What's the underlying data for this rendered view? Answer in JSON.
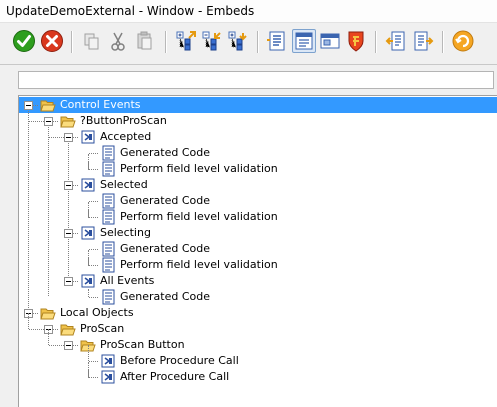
{
  "window": {
    "title": "UpdateDemoExternal - Window - Embeds"
  },
  "toolbar": {
    "buttons": [
      {
        "name": "ok-icon",
        "color": "#2e9e1e"
      },
      {
        "name": "cancel-icon",
        "color": "#d9381e"
      },
      {
        "name": "copy-icon"
      },
      {
        "name": "cut-icon"
      },
      {
        "name": "paste-icon"
      },
      {
        "name": "expand-all-icon"
      },
      {
        "name": "collapse-all-icon"
      },
      {
        "name": "expand-filled-icon"
      },
      {
        "name": "source-icon"
      },
      {
        "name": "embeds-view-icon",
        "pressed": true
      },
      {
        "name": "window-icon"
      },
      {
        "name": "shield-icon"
      },
      {
        "name": "previous-embed-icon"
      },
      {
        "name": "next-embed-icon"
      },
      {
        "name": "refresh-icon"
      }
    ]
  },
  "search": {
    "value": ""
  },
  "tree": {
    "items": [
      {
        "label": "Control Events",
        "type": "folder",
        "selected": true
      },
      {
        "label": "?ButtonProScan",
        "type": "folder"
      },
      {
        "label": "Accepted",
        "type": "event"
      },
      {
        "label": "Generated Code",
        "type": "code"
      },
      {
        "label": "Perform field level validation",
        "type": "code"
      },
      {
        "label": "Selected",
        "type": "event"
      },
      {
        "label": "Generated Code",
        "type": "code"
      },
      {
        "label": "Perform field level validation",
        "type": "code"
      },
      {
        "label": "Selecting",
        "type": "event"
      },
      {
        "label": "Generated Code",
        "type": "code"
      },
      {
        "label": "Perform field level validation",
        "type": "code"
      },
      {
        "label": "All Events",
        "type": "event"
      },
      {
        "label": "Generated Code",
        "type": "code"
      },
      {
        "label": "Local Objects",
        "type": "folder"
      },
      {
        "label": "ProScan",
        "type": "folder"
      },
      {
        "label": "ProScan Button",
        "type": "folder"
      },
      {
        "label": "Before Procedure Call",
        "type": "event"
      },
      {
        "label": "After Procedure Call",
        "type": "event"
      }
    ]
  }
}
